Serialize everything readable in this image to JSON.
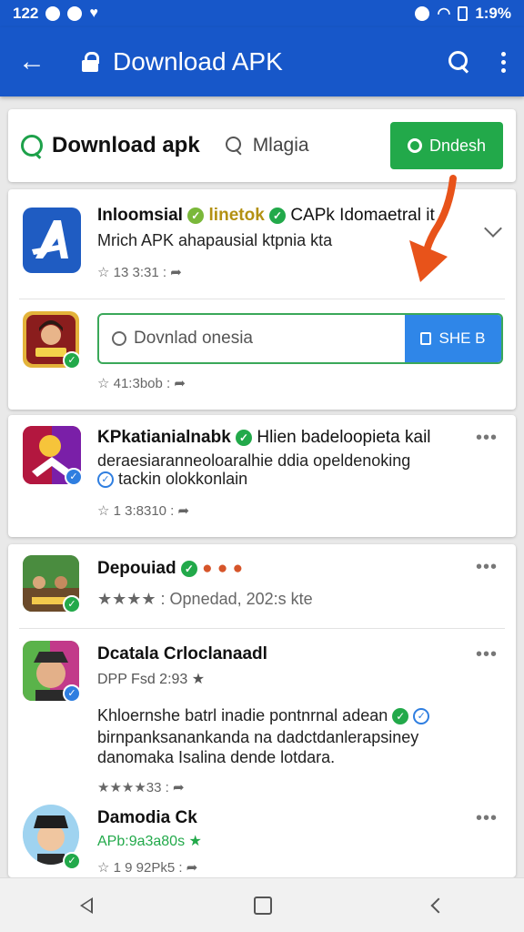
{
  "statusbar": {
    "time": "122",
    "battery": "1:9%"
  },
  "appbar": {
    "title": "Download APK"
  },
  "search": {
    "title": "Download apk",
    "query": "Mlagia",
    "button_label": "Dndesh"
  },
  "apps": [
    {
      "title": "Inloomsial",
      "title_tag": "linetok",
      "title_suffix": "CAPk Idomaetral it",
      "subtitle": "Mrich APK ahapausial ktpnia kta",
      "meta": "13 3:31 : ",
      "field_placeholder": "Dovnlad onesia",
      "field_button": "SHE B",
      "meta2": "41:3bob : "
    },
    {
      "title": "KPkatianialnabk",
      "title_suffix": "Hlien badeloopieta kail",
      "subtitle": "deraesiaranneoloaralhie ddia opeldenoking",
      "subtitle2": "tackin olokkonlain",
      "meta": "1 3:8310 : "
    },
    {
      "title": "Depouiad",
      "meta": "★★★★ : Opnedad, 202:s kte"
    },
    {
      "title": "Dcatala Crloclanaadl",
      "subtitle": "DPP Fsd 2:93 ★",
      "desc1": "Khloernshe batrl inadie pontnrnal adean",
      "desc2": "birnpanksanankanda na dadctdanlerapsiney",
      "desc3": "danomaka Isalina dende lotdara.",
      "meta": "★★★★33 : "
    },
    {
      "title": "Damodia Ck",
      "subtitle": "APb:9a3a80s ★",
      "meta": "1 9 92Pk5 : "
    }
  ],
  "colors": {
    "primary": "#1757c9",
    "green": "#22a94a",
    "blue": "#2f86e8",
    "arrow": "#e8531a"
  }
}
